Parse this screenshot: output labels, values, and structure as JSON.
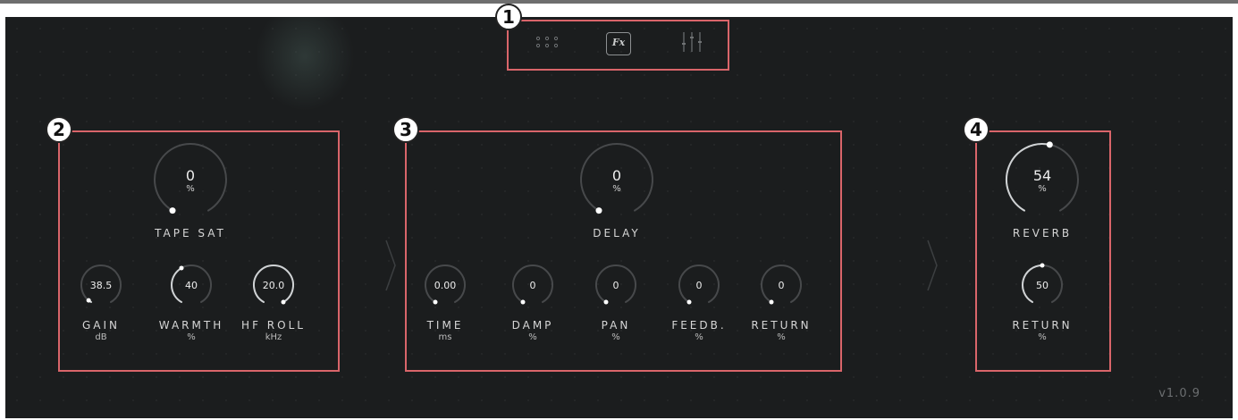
{
  "nav": {
    "items": [
      {
        "icon": "dot-grid-icon",
        "active": false
      },
      {
        "icon": "fx-icon",
        "label": "Fx",
        "active": true
      },
      {
        "icon": "mixer-sliders-icon",
        "active": false
      }
    ]
  },
  "sections": {
    "tape": {
      "main": {
        "value": "0",
        "unit": "%",
        "label": "TAPE SAT",
        "fraction": 0.0
      },
      "small": [
        {
          "value": "38.5",
          "label": "GAIN",
          "unit": "dB",
          "fraction": 0.03
        },
        {
          "value": "40",
          "label": "WARMTH",
          "unit": "%",
          "fraction": 0.4
        },
        {
          "value": "20.0",
          "label": "HF ROLL",
          "unit": "kHz",
          "fraction": 1.0
        }
      ]
    },
    "delay": {
      "main": {
        "value": "0",
        "unit": "%",
        "label": "DELAY",
        "fraction": 0.0
      },
      "small": [
        {
          "value": "0.00",
          "label": "TIME",
          "unit": "ms",
          "fraction": 0.0
        },
        {
          "value": "0",
          "label": "DAMP",
          "unit": "%",
          "fraction": 0.0
        },
        {
          "value": "0",
          "label": "PAN",
          "unit": "%",
          "fraction": 0.0
        },
        {
          "value": "0",
          "label": "FEEDB.",
          "unit": "%",
          "fraction": 0.0
        },
        {
          "value": "0",
          "label": "RETURN",
          "unit": "%",
          "fraction": 0.0
        }
      ]
    },
    "reverb": {
      "main": {
        "value": "54",
        "unit": "%",
        "label": "REVERB",
        "fraction": 0.54
      },
      "small": [
        {
          "value": "50",
          "label": "RETURN",
          "unit": "%",
          "fraction": 0.5
        }
      ]
    }
  },
  "callouts": [
    "1",
    "2",
    "3",
    "4"
  ],
  "version": "v1.0.9",
  "colors": {
    "background": "#1b1d1e",
    "arc": "#47494b",
    "arc_active": "#cfd2d4",
    "highlight": "#d9656a"
  }
}
